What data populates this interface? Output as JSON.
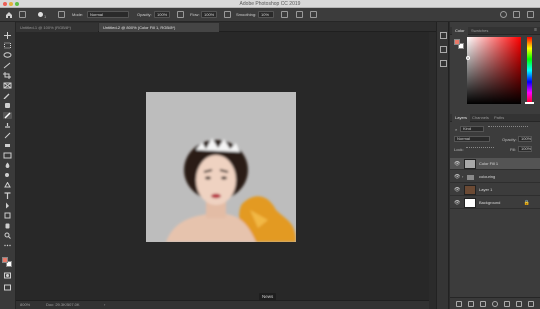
{
  "app": {
    "title": "Adobe Photoshop CC 2019"
  },
  "options": {
    "mode_label": "Mode:",
    "mode_value": "Normal",
    "opacity_label": "Opacity:",
    "opacity_value": "100%",
    "flow_label": "Flow:",
    "flow_value": "100%",
    "smoothing_label": "Smoothing:",
    "smoothing_value": "10%",
    "brush_size": "1"
  },
  "tabs": [
    {
      "label": "Untitled-1 @ 100% (RGB/8*)"
    },
    {
      "label": "Untitled-2 @ 800% (Color Fill 1, RGB/8*)"
    }
  ],
  "status": {
    "zoom": "800%",
    "doc_info": "Doc: 29.3K/507.0K"
  },
  "tooltip": {
    "label": "News"
  },
  "right_panel": {
    "color_tabs": [
      "Color",
      "Swatches"
    ],
    "layer_tabs": [
      "Layers",
      "Channels",
      "Paths"
    ],
    "kind_value": "Kind",
    "blend_value": "Normal",
    "opacity_label": "Opacity:",
    "opacity_value": "100%",
    "lock_label": "Lock:",
    "fill_label": "Fill:",
    "fill_value": "100%",
    "layers": [
      {
        "name": "Color Fill 1",
        "selected": true,
        "thumb_color": "#a8a8a8"
      },
      {
        "name": "colouring",
        "selected": false,
        "thumb_color": "#3c3c3c"
      },
      {
        "name": "Layer 1",
        "selected": false,
        "thumb_color": "#6b4a34"
      },
      {
        "name": "Background",
        "selected": false,
        "thumb_color": "#ffffff"
      }
    ]
  },
  "colors": {
    "foreground": "#e87a6a",
    "background": "#ffffff",
    "canvas_fill": "#bdbdbd",
    "dress_orange": "#e39a22"
  }
}
